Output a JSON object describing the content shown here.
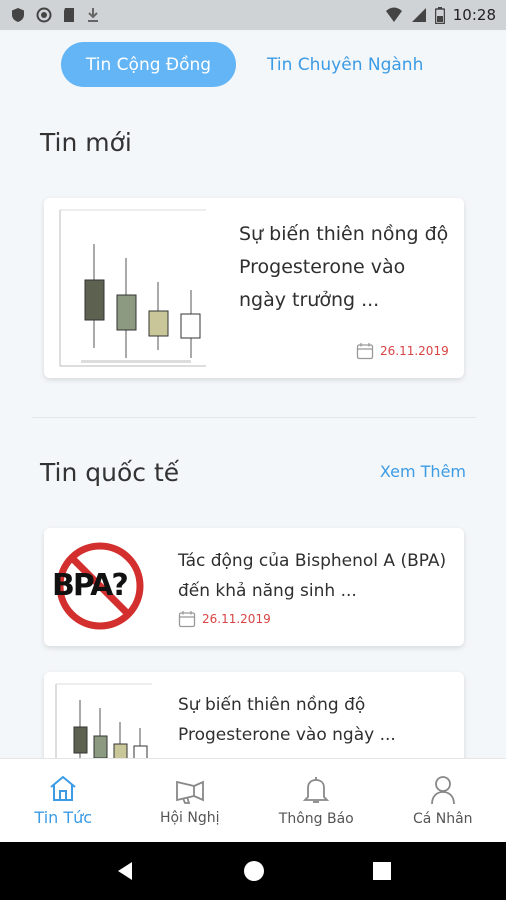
{
  "status_bar": {
    "time": "10:28"
  },
  "tabs": [
    {
      "label": "Tin Cộng Đồng",
      "active": true
    },
    {
      "label": "Tin Chuyên Ngành",
      "active": false
    }
  ],
  "sections": {
    "new": {
      "title": "Tin mới",
      "article": {
        "title": "Sự biến thiên nồng độ Progesterone vào ngày trưởng ...",
        "date": "26.11.2019"
      }
    },
    "international": {
      "title": "Tin quốc tế",
      "see_more": "Xem Thêm",
      "articles": [
        {
          "title": "Tác động của Bisphenol A (BPA) đến khả năng sinh ...",
          "date": "26.11.2019",
          "thumb_text": "BPA?"
        },
        {
          "title": "Sự biến thiên nồng độ Progesterone vào ngày ...",
          "date": ""
        }
      ]
    }
  },
  "bottom_nav": [
    {
      "label": "Tin Tức",
      "icon": "home-icon",
      "active": true
    },
    {
      "label": "Hội Nghị",
      "icon": "megaphone-icon",
      "active": false
    },
    {
      "label": "Thông Báo",
      "icon": "bell-icon",
      "active": false
    },
    {
      "label": "Cá Nhân",
      "icon": "person-icon",
      "active": false
    }
  ],
  "colors": {
    "accent": "#3b9be5",
    "pill": "#64b5f6",
    "date": "#d84444"
  }
}
